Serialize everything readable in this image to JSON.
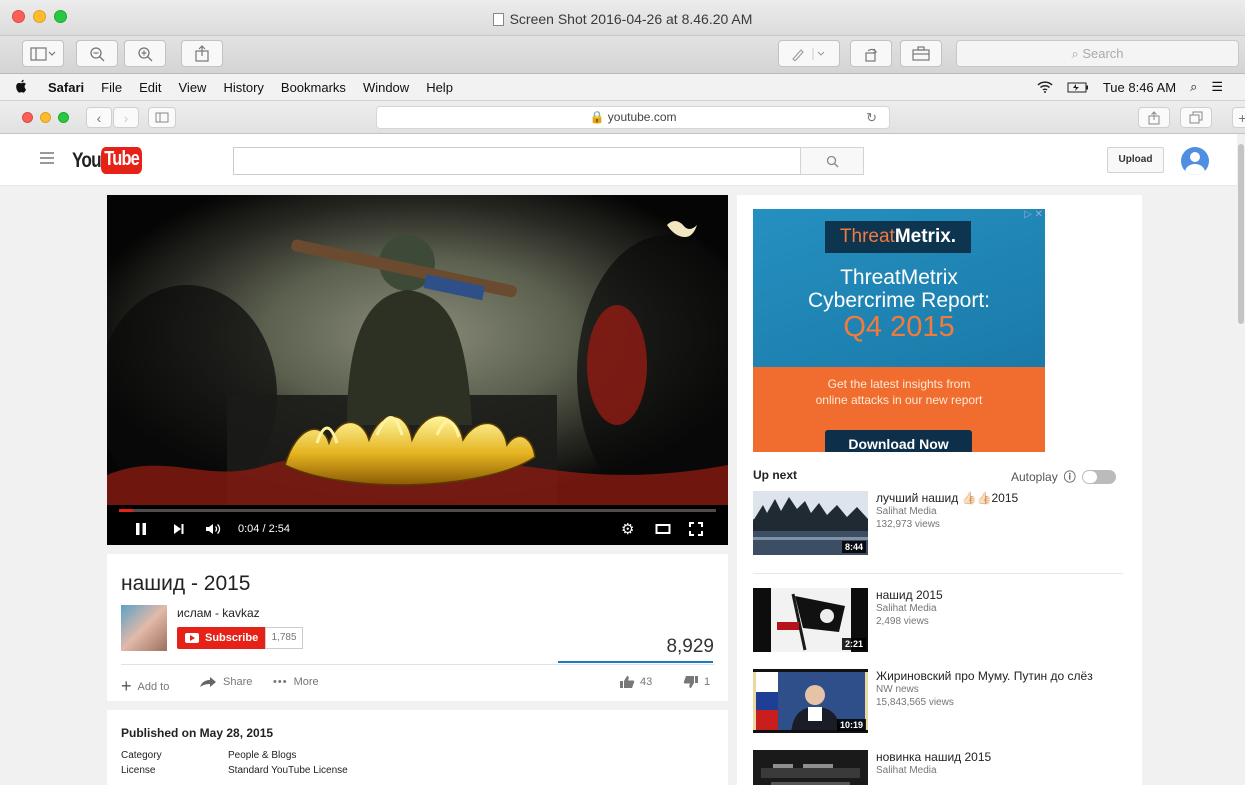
{
  "preview": {
    "title": "Screen Shot 2016-04-26 at 8.46.20 AM",
    "search_placeholder": "Search",
    "icons": [
      "sidebar-icon",
      "zoom-out-icon",
      "zoom-in-icon",
      "share-icon",
      "markup-icon",
      "rotate-icon",
      "toolbox-icon"
    ]
  },
  "menubar": {
    "items": [
      "Safari",
      "File",
      "Edit",
      "View",
      "History",
      "Bookmarks",
      "Window",
      "Help"
    ],
    "clock": "Tue 8:46 AM"
  },
  "safari": {
    "url": "youtube.com"
  },
  "youtube": {
    "logo_you": "You",
    "logo_tube": "Tube",
    "upload_label": "Upload",
    "player": {
      "time": "0:04 / 2:54",
      "progress_fraction": 0.023
    },
    "video": {
      "title": "нашид - 2015",
      "owner": "ислам - kavkaz",
      "subscribe_label": "Subscribe",
      "subscriber_count": "1,785",
      "views": "8,929",
      "add_to_label": "Add to",
      "share_label": "Share",
      "more_label": "More",
      "likes": "43",
      "dislikes": "1"
    },
    "description": {
      "published": "Published on May 28, 2015",
      "category_label": "Category",
      "category_value": "People & Blogs",
      "license_label": "License",
      "license_value": "Standard YouTube License"
    },
    "ad": {
      "brand_a": "Threat",
      "brand_b": "Metrix.",
      "headline_1": "ThreatMetrix",
      "headline_2": "Cybercrime Report:",
      "headline_3": "Q4 2015",
      "sub_1": "Get the latest insights from",
      "sub_2": "online attacks in our new report",
      "cta": "Download Now"
    },
    "up_next_label": "Up next",
    "autoplay_label": "Autoplay",
    "recommendations": [
      {
        "title": "лучший нашид 👍🏻👍🏻2015",
        "channel": "Salihat Media",
        "views": "132,973 views",
        "duration": "8:44"
      },
      {
        "title": "нашид 2015",
        "channel": "Salihat Media",
        "views": "2,498 views",
        "duration": "2:21"
      },
      {
        "title": "Жириновский про Муму. Путин до слёз",
        "channel": "NW news",
        "views": "15,843,565 views",
        "duration": "10:19"
      },
      {
        "title": "новинка нашид 2015",
        "channel": "Salihat Media",
        "views": "",
        "duration": ""
      }
    ]
  },
  "colors": {
    "yt_red": "#e62117",
    "ad_blue": "#1d87b7",
    "ad_orange": "#f06d2f",
    "progress_blue": "#167ac6"
  }
}
